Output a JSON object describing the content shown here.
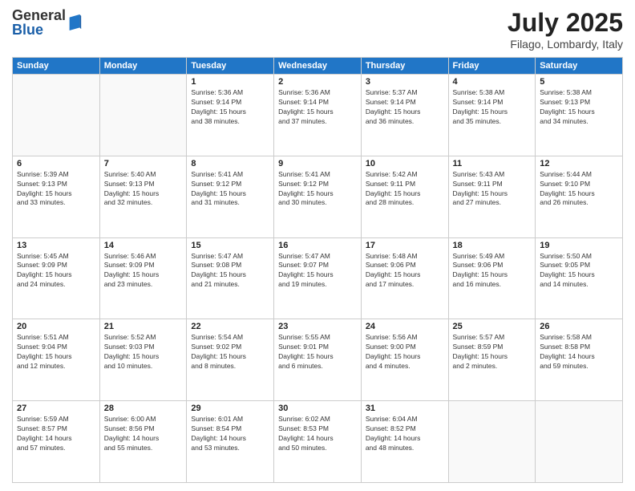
{
  "logo": {
    "general": "General",
    "blue": "Blue"
  },
  "title": "July 2025",
  "location": "Filago, Lombardy, Italy",
  "days_of_week": [
    "Sunday",
    "Monday",
    "Tuesday",
    "Wednesday",
    "Thursday",
    "Friday",
    "Saturday"
  ],
  "weeks": [
    [
      {
        "day": "",
        "info": ""
      },
      {
        "day": "",
        "info": ""
      },
      {
        "day": "1",
        "info": "Sunrise: 5:36 AM\nSunset: 9:14 PM\nDaylight: 15 hours\nand 38 minutes."
      },
      {
        "day": "2",
        "info": "Sunrise: 5:36 AM\nSunset: 9:14 PM\nDaylight: 15 hours\nand 37 minutes."
      },
      {
        "day": "3",
        "info": "Sunrise: 5:37 AM\nSunset: 9:14 PM\nDaylight: 15 hours\nand 36 minutes."
      },
      {
        "day": "4",
        "info": "Sunrise: 5:38 AM\nSunset: 9:14 PM\nDaylight: 15 hours\nand 35 minutes."
      },
      {
        "day": "5",
        "info": "Sunrise: 5:38 AM\nSunset: 9:13 PM\nDaylight: 15 hours\nand 34 minutes."
      }
    ],
    [
      {
        "day": "6",
        "info": "Sunrise: 5:39 AM\nSunset: 9:13 PM\nDaylight: 15 hours\nand 33 minutes."
      },
      {
        "day": "7",
        "info": "Sunrise: 5:40 AM\nSunset: 9:13 PM\nDaylight: 15 hours\nand 32 minutes."
      },
      {
        "day": "8",
        "info": "Sunrise: 5:41 AM\nSunset: 9:12 PM\nDaylight: 15 hours\nand 31 minutes."
      },
      {
        "day": "9",
        "info": "Sunrise: 5:41 AM\nSunset: 9:12 PM\nDaylight: 15 hours\nand 30 minutes."
      },
      {
        "day": "10",
        "info": "Sunrise: 5:42 AM\nSunset: 9:11 PM\nDaylight: 15 hours\nand 28 minutes."
      },
      {
        "day": "11",
        "info": "Sunrise: 5:43 AM\nSunset: 9:11 PM\nDaylight: 15 hours\nand 27 minutes."
      },
      {
        "day": "12",
        "info": "Sunrise: 5:44 AM\nSunset: 9:10 PM\nDaylight: 15 hours\nand 26 minutes."
      }
    ],
    [
      {
        "day": "13",
        "info": "Sunrise: 5:45 AM\nSunset: 9:09 PM\nDaylight: 15 hours\nand 24 minutes."
      },
      {
        "day": "14",
        "info": "Sunrise: 5:46 AM\nSunset: 9:09 PM\nDaylight: 15 hours\nand 23 minutes."
      },
      {
        "day": "15",
        "info": "Sunrise: 5:47 AM\nSunset: 9:08 PM\nDaylight: 15 hours\nand 21 minutes."
      },
      {
        "day": "16",
        "info": "Sunrise: 5:47 AM\nSunset: 9:07 PM\nDaylight: 15 hours\nand 19 minutes."
      },
      {
        "day": "17",
        "info": "Sunrise: 5:48 AM\nSunset: 9:06 PM\nDaylight: 15 hours\nand 17 minutes."
      },
      {
        "day": "18",
        "info": "Sunrise: 5:49 AM\nSunset: 9:06 PM\nDaylight: 15 hours\nand 16 minutes."
      },
      {
        "day": "19",
        "info": "Sunrise: 5:50 AM\nSunset: 9:05 PM\nDaylight: 15 hours\nand 14 minutes."
      }
    ],
    [
      {
        "day": "20",
        "info": "Sunrise: 5:51 AM\nSunset: 9:04 PM\nDaylight: 15 hours\nand 12 minutes."
      },
      {
        "day": "21",
        "info": "Sunrise: 5:52 AM\nSunset: 9:03 PM\nDaylight: 15 hours\nand 10 minutes."
      },
      {
        "day": "22",
        "info": "Sunrise: 5:54 AM\nSunset: 9:02 PM\nDaylight: 15 hours\nand 8 minutes."
      },
      {
        "day": "23",
        "info": "Sunrise: 5:55 AM\nSunset: 9:01 PM\nDaylight: 15 hours\nand 6 minutes."
      },
      {
        "day": "24",
        "info": "Sunrise: 5:56 AM\nSunset: 9:00 PM\nDaylight: 15 hours\nand 4 minutes."
      },
      {
        "day": "25",
        "info": "Sunrise: 5:57 AM\nSunset: 8:59 PM\nDaylight: 15 hours\nand 2 minutes."
      },
      {
        "day": "26",
        "info": "Sunrise: 5:58 AM\nSunset: 8:58 PM\nDaylight: 14 hours\nand 59 minutes."
      }
    ],
    [
      {
        "day": "27",
        "info": "Sunrise: 5:59 AM\nSunset: 8:57 PM\nDaylight: 14 hours\nand 57 minutes."
      },
      {
        "day": "28",
        "info": "Sunrise: 6:00 AM\nSunset: 8:56 PM\nDaylight: 14 hours\nand 55 minutes."
      },
      {
        "day": "29",
        "info": "Sunrise: 6:01 AM\nSunset: 8:54 PM\nDaylight: 14 hours\nand 53 minutes."
      },
      {
        "day": "30",
        "info": "Sunrise: 6:02 AM\nSunset: 8:53 PM\nDaylight: 14 hours\nand 50 minutes."
      },
      {
        "day": "31",
        "info": "Sunrise: 6:04 AM\nSunset: 8:52 PM\nDaylight: 14 hours\nand 48 minutes."
      },
      {
        "day": "",
        "info": ""
      },
      {
        "day": "",
        "info": ""
      }
    ]
  ]
}
